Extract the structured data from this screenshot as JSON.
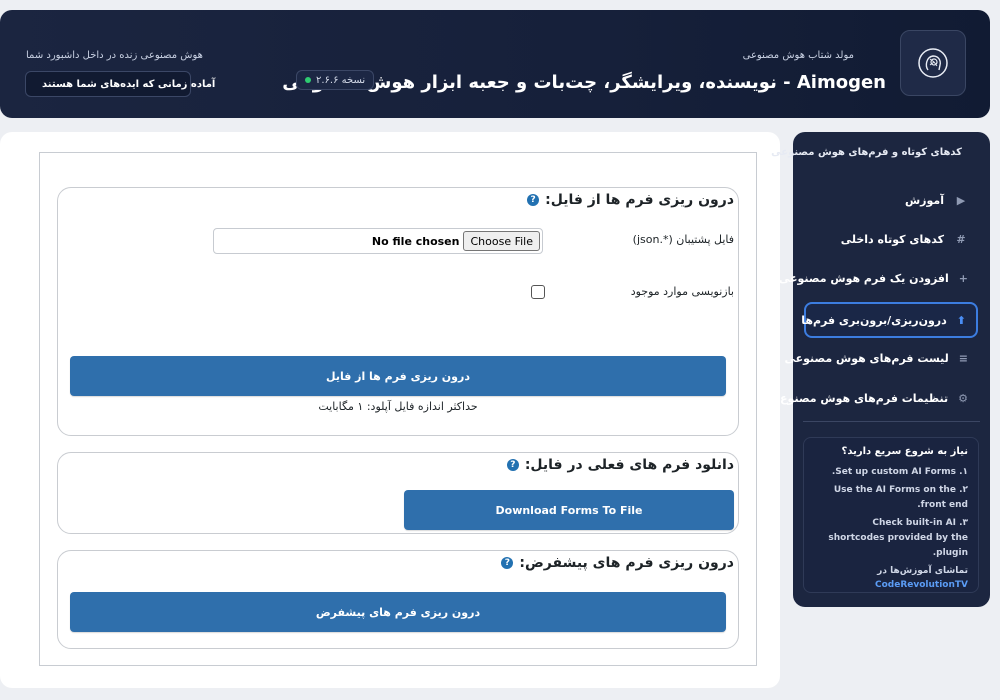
{
  "header": {
    "subtitle": "مولد شتاب هوش مصنوعی",
    "title": "Aimogen - نویسنده، ویرایشگر، چت‌بات و جعبه ابزار هوش مصنوعی",
    "version": "نسخه ۲.۶.۶",
    "left_subtitle": "هوش مصنوعی زنده در داخل داشبورد شما",
    "ready_badge": "آماده زمانی که ایده‌های شما هستند",
    "logo_icon": "ai-head-icon"
  },
  "sidebar": {
    "title": "کدهای کوتاه و فرم‌های هوش مصنوعی",
    "items": [
      {
        "label": "آموزش",
        "icon": "play-icon"
      },
      {
        "label": "کدهای کوتاه داخلی",
        "icon": "hash-icon"
      },
      {
        "label": "افزودن یک فرم هوش مصنوعی",
        "icon": "plus-icon"
      },
      {
        "label": "درون‌ریزی/برون‌بری فرم‌ها",
        "icon": "upload-icon",
        "active": true
      },
      {
        "label": "لیست فرم‌های هوش مصنوعی",
        "icon": "list-icon"
      },
      {
        "label": "تنظیمات فرم‌های هوش مصنوع",
        "icon": "settings-icon"
      }
    ],
    "tips": {
      "title": "نیاز به شروع سریع دارید؟",
      "items": [
        "۱. Set up custom AI Forms.",
        "۲. Use the AI Forms on the front end.",
        "۳. Check built-in AI shortcodes provided by the plugin."
      ],
      "footer_text": "تماشای آموزش‌ها در",
      "footer_link": "CodeRevolutionTV"
    }
  },
  "import_section": {
    "title": "درون ریزی فرم ها از فایل:",
    "file_label": "فایل پشتیبان (*.json)",
    "file_status": "No file chosen",
    "choose_button": "Choose File",
    "overwrite_label": "بازنویسی موارد موجود",
    "overwrite_checked": false,
    "submit_button": "درون ریزی فرم ها از فایل",
    "max_size_note": "حداکثر اندازه فایل آپلود: ۱ مگابایت"
  },
  "download_section": {
    "title": "دانلود فرم های فعلی در فایل:",
    "button": "Download Forms To File"
  },
  "default_section": {
    "title": "درون ریزی فرم های پیشفرض:",
    "button": "درون ریزی فرم های پیشفرض"
  },
  "colors": {
    "header_bg": "#1b2540",
    "sidebar_bg": "#1c2640",
    "primary_button": "#2f6fac",
    "help_icon": "#2271b1",
    "active_border": "#3c7de0"
  }
}
